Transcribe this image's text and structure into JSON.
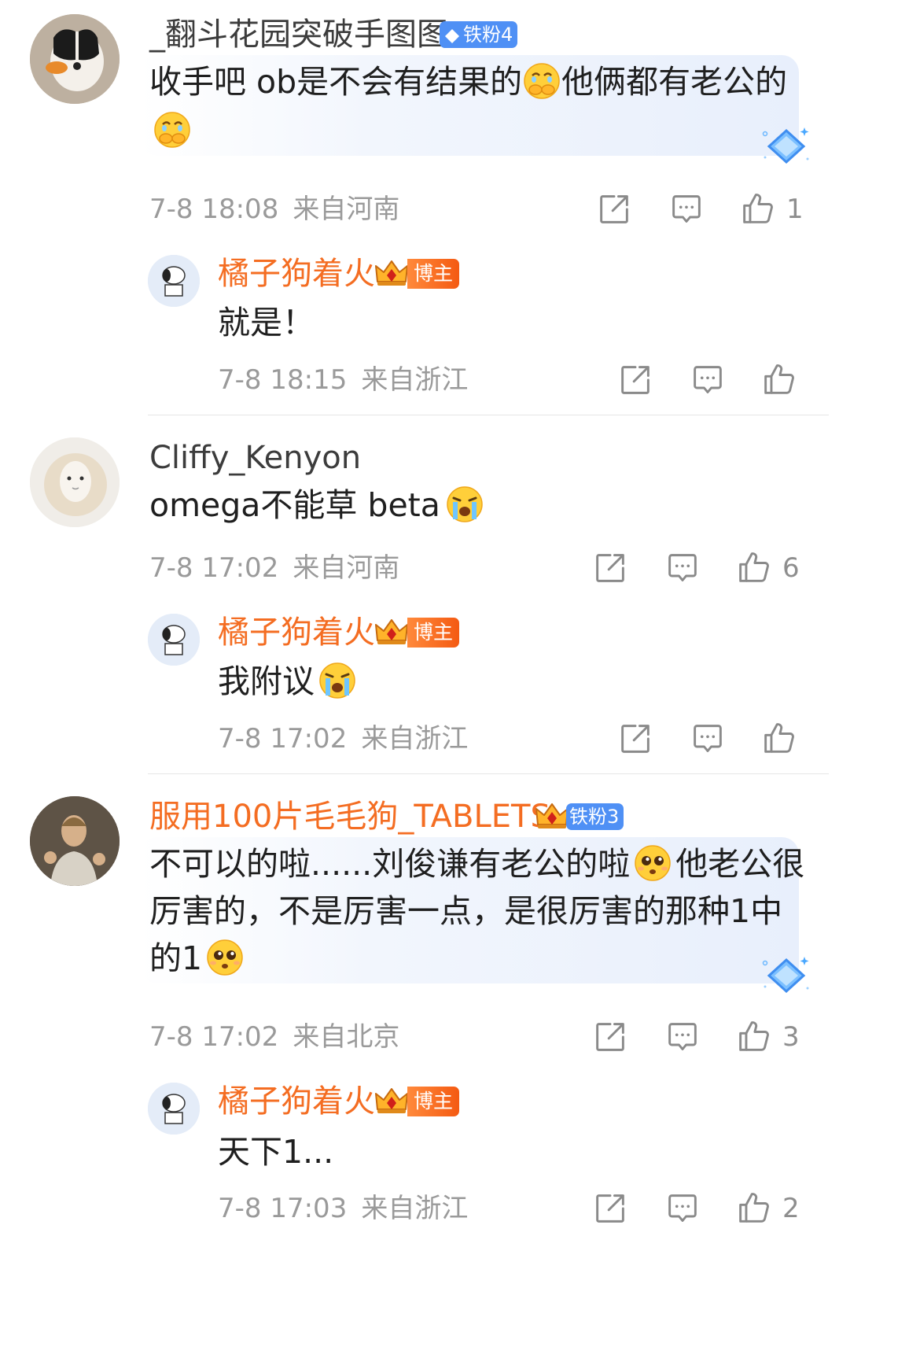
{
  "threads": [
    {
      "comment": {
        "username": "_翻斗花园突破手图图",
        "badge": "铁粉4",
        "text_line1": "收手吧 ob是不会有结果的",
        "text_line1b": "他俩都有老公的",
        "date": "7-8 18:08",
        "location": "来自河南",
        "like_count": "1"
      },
      "reply": {
        "username": "橘子狗着火",
        "badge": "博主",
        "text": "就是！",
        "date": "7-8 18:15",
        "location": "来自浙江"
      }
    },
    {
      "comment": {
        "username": "Cliffy_Kenyon",
        "text": "omega不能草 beta",
        "date": "7-8 17:02",
        "location": "来自河南",
        "like_count": "6"
      },
      "reply": {
        "username": "橘子狗着火",
        "badge": "博主",
        "text": "我附议",
        "date": "7-8 17:02",
        "location": "来自浙江"
      }
    },
    {
      "comment": {
        "username": "服用100片毛毛狗_TABLETS",
        "badge": "铁粉3",
        "text_line1a": "不可以的啦......刘俊谦有老公的啦",
        "text_line1b": "他老公很",
        "text_line2": "厉害的，不是厉害一点，是很厉害的那种1中",
        "text_line3": "的1",
        "date": "7-8 17:02",
        "location": "来自北京",
        "like_count": "3"
      },
      "reply": {
        "username": "橘子狗着火",
        "badge": "博主",
        "text": "天下1...",
        "date": "7-8 17:03",
        "location": "来自浙江",
        "like_count": "2"
      }
    }
  ],
  "colors": {
    "orange_name": "#f46d22",
    "fan_badge": "#4f90f5",
    "meta_gray": "#9a9a9a"
  },
  "icons": [
    "share-icon",
    "comment-icon",
    "thumbs-up-icon",
    "diamond-sparkle-icon",
    "cover-mouth-cry-emoji",
    "loud-cry-emoji",
    "pleading-emoji"
  ]
}
